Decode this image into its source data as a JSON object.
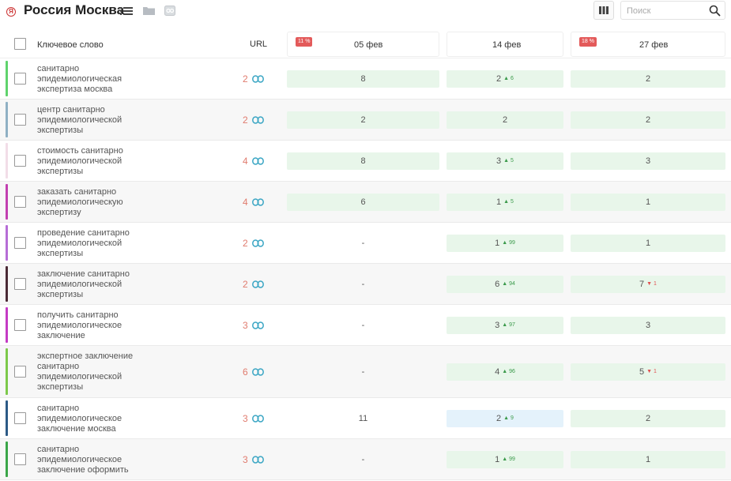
{
  "header": {
    "region_title": "Россия Москва",
    "search_placeholder": "Поиск"
  },
  "table": {
    "columns": {
      "keyword": "Ключевое слово",
      "url": "URL",
      "dates": [
        {
          "label": "05 фев",
          "badge": "11 %"
        },
        {
          "label": "14 фев",
          "badge": ""
        },
        {
          "label": "27 фев",
          "badge": "18 %"
        }
      ]
    },
    "rows": [
      {
        "keyword": [
          "санитарно",
          "эпидемиологическая",
          "экспертиза москва"
        ],
        "url_count": "2",
        "color": "#5fd36c",
        "positions": [
          {
            "value": "8",
            "fill": "green"
          },
          {
            "value": "2",
            "change": "6",
            "dir": "up",
            "fill": "green"
          },
          {
            "value": "2",
            "fill": "green"
          }
        ]
      },
      {
        "keyword": [
          "центр санитарно",
          "эпидемиологической",
          "экспертизы"
        ],
        "url_count": "2",
        "color": "#8fb0c4",
        "positions": [
          {
            "value": "2",
            "fill": "green"
          },
          {
            "value": "2",
            "fill": "green"
          },
          {
            "value": "2",
            "fill": "green"
          }
        ]
      },
      {
        "keyword": [
          "стоимость санитарно",
          "эпидемиологической",
          "экспертизы"
        ],
        "url_count": "4",
        "color": "#f2dde8",
        "positions": [
          {
            "value": "8",
            "fill": "green"
          },
          {
            "value": "3",
            "change": "5",
            "dir": "up",
            "fill": "green"
          },
          {
            "value": "3",
            "fill": "green"
          }
        ]
      },
      {
        "keyword": [
          "заказать санитарно",
          "эпидемиологическую",
          "экспертизу"
        ],
        "url_count": "4",
        "color": "#c23fb0",
        "positions": [
          {
            "value": "6",
            "fill": "green"
          },
          {
            "value": "1",
            "change": "5",
            "dir": "up",
            "fill": "green"
          },
          {
            "value": "1",
            "fill": "green"
          }
        ]
      },
      {
        "keyword": [
          "проведение санитарно",
          "эпидемиологической",
          "экспертизы"
        ],
        "url_count": "2",
        "color": "#b66dd6",
        "positions": [
          {
            "value": "-",
            "fill": "none"
          },
          {
            "value": "1",
            "change": "99",
            "dir": "up",
            "fill": "green"
          },
          {
            "value": "1",
            "fill": "green"
          }
        ]
      },
      {
        "keyword": [
          "заключение санитарно",
          "эпидемиологической",
          "экспертизы"
        ],
        "url_count": "2",
        "color": "#4a2a35",
        "positions": [
          {
            "value": "-",
            "fill": "none"
          },
          {
            "value": "6",
            "change": "94",
            "dir": "up",
            "fill": "green"
          },
          {
            "value": "7",
            "change": "1",
            "dir": "down",
            "fill": "green"
          }
        ]
      },
      {
        "keyword": [
          "получить санитарно",
          "эпидемиологическое",
          "заключение"
        ],
        "url_count": "3",
        "color": "#c43bc4",
        "positions": [
          {
            "value": "-",
            "fill": "none"
          },
          {
            "value": "3",
            "change": "97",
            "dir": "up",
            "fill": "green"
          },
          {
            "value": "3",
            "fill": "green"
          }
        ]
      },
      {
        "keyword": [
          "экспертное заключение",
          "санитарно",
          "эпидемиологической",
          "экспертизы"
        ],
        "url_count": "6",
        "color": "#7dc94a",
        "positions": [
          {
            "value": "-",
            "fill": "none"
          },
          {
            "value": "4",
            "change": "96",
            "dir": "up",
            "fill": "green"
          },
          {
            "value": "5",
            "change": "1",
            "dir": "down",
            "fill": "green"
          }
        ]
      },
      {
        "keyword": [
          "санитарно",
          "эпидемиологическое",
          "заключение москва"
        ],
        "url_count": "3",
        "color": "#2c5a86",
        "positions": [
          {
            "value": "11",
            "fill": "none"
          },
          {
            "value": "2",
            "change": "9",
            "dir": "up",
            "fill": "blue"
          },
          {
            "value": "2",
            "fill": "green"
          }
        ]
      },
      {
        "keyword": [
          "санитарно",
          "эпидемиологическое",
          "заключение оформить"
        ],
        "url_count": "3",
        "color": "#3aa648",
        "positions": [
          {
            "value": "-",
            "fill": "none"
          },
          {
            "value": "1",
            "change": "99",
            "dir": "up",
            "fill": "green"
          },
          {
            "value": "1",
            "fill": "green"
          }
        ]
      }
    ]
  },
  "colors": {
    "accent_red": "#e35a5a",
    "url_count": "#e07b6e",
    "cell_green": "#e8f6ea",
    "cell_blue": "#e4f2fb",
    "up": "#3a9a4a",
    "down": "#e05050"
  },
  "icons": [
    "yandex-icon",
    "list-icon",
    "folder-icon",
    "seo-icon",
    "columns-icon",
    "search-icon",
    "link-icon"
  ]
}
